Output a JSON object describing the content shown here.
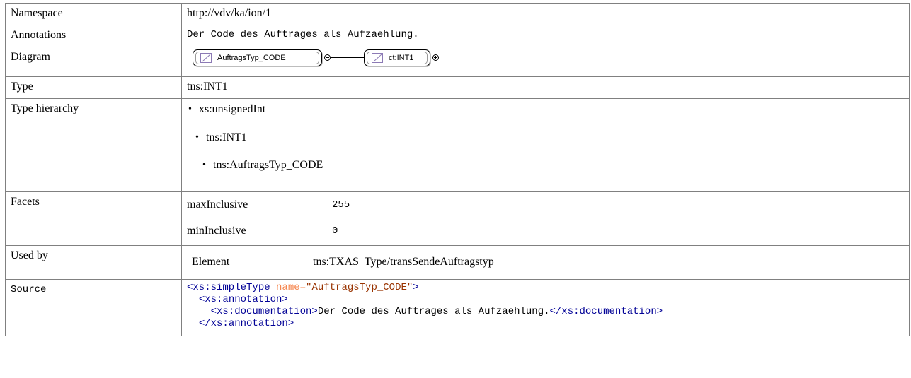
{
  "rows": {
    "namespace": {
      "label": "Namespace",
      "value": "http://vdv/ka/ion/1"
    },
    "annotations": {
      "label": "Annotations",
      "value": "Der Code des Auftrages als Aufzaehlung."
    },
    "diagram": {
      "label": "Diagram",
      "node1": "AuftragsTyp_CODE",
      "node2": "ct:INT1"
    },
    "type": {
      "label": "Type",
      "value": "tns:INT1"
    },
    "hierarchy": {
      "label": "Type hierarchy",
      "items": [
        "xs:unsignedInt",
        "tns:INT1",
        "tns:AuftragsTyp_CODE"
      ]
    },
    "facets": {
      "label": "Facets",
      "items": [
        {
          "name": "maxInclusive",
          "value": "255"
        },
        {
          "name": "minInclusive",
          "value": "0"
        }
      ]
    },
    "used_by": {
      "label": "Used by",
      "kind": "Element",
      "target": "tns:TXAS_Type/transSendeAuftragstyp"
    },
    "source": {
      "label": "Source",
      "line1_open": "<xs:simpleType",
      "line1_attn": "name=",
      "line1_attv": "\"AuftragsTyp_CODE\"",
      "line1_close": ">",
      "line2": "<xs:annotation>",
      "line3_open": "<xs:documentation>",
      "line3_text": "Der Code des Auftrages als Aufzaehlung.",
      "line3_close": "</xs:documentation>",
      "line4": "</xs:annotation>"
    }
  },
  "colors": {
    "border": "#808080",
    "tag": "#000096",
    "attribute_name": "#f5844c",
    "attribute_value": "#993300"
  }
}
